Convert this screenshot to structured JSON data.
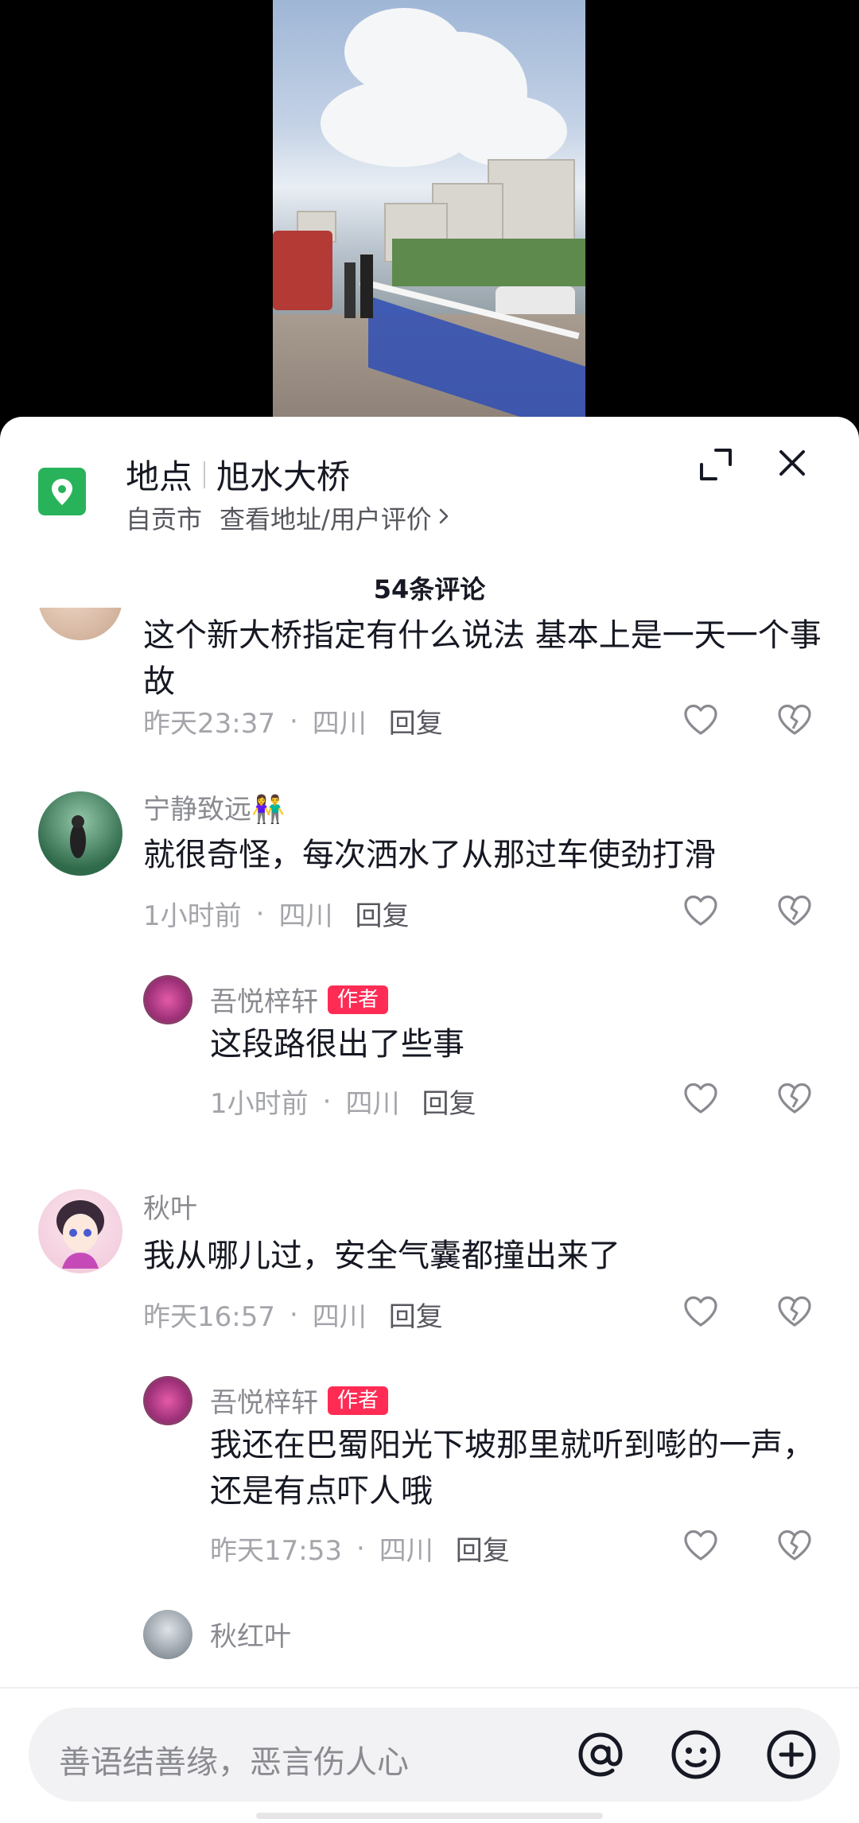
{
  "location": {
    "label": "地点",
    "name": "旭水大桥",
    "city": "自贡市",
    "link": "查看地址/用户评价",
    "icon": "map-pin-icon"
  },
  "header_actions": {
    "expand_icon": "expand-icon",
    "close_icon": "close-icon"
  },
  "comments_count": "54条评论",
  "comments": [
    {
      "text": "这个新大桥指定有什么说法 基本上是一天一个事故",
      "time": "昨天23:37",
      "region": "四川",
      "reply": "回复"
    },
    {
      "user": "宁静致远👫",
      "text": "就很奇怪，每次洒水了从那过车使劲打滑",
      "time": "1小时前",
      "region": "四川",
      "reply": "回复",
      "replies": [
        {
          "user": "吾悦梓轩",
          "tag": "作者",
          "text": "这段路很出了些事",
          "time": "1小时前",
          "region": "四川",
          "reply": "回复"
        }
      ]
    },
    {
      "user": "秋叶",
      "text": "我从哪儿过，安全气囊都撞出来了",
      "time": "昨天16:57",
      "region": "四川",
      "reply": "回复",
      "replies": [
        {
          "user": "吾悦梓轩",
          "tag": "作者",
          "text": "我还在巴蜀阳光下坡那里就听到嘭的一声，还是有点吓人哦",
          "time": "昨天17:53",
          "region": "四川",
          "reply": "回复"
        },
        {
          "user": "秋红叶"
        }
      ]
    }
  ],
  "separator": "·",
  "input": {
    "placeholder": "善语结善缘，恶言伤人心",
    "icons": [
      "at-icon",
      "emoji-icon",
      "plus-icon"
    ]
  },
  "colors": {
    "accent": "#fe2c55",
    "pin": "#28b35a",
    "muted": "#a4a5aa"
  }
}
